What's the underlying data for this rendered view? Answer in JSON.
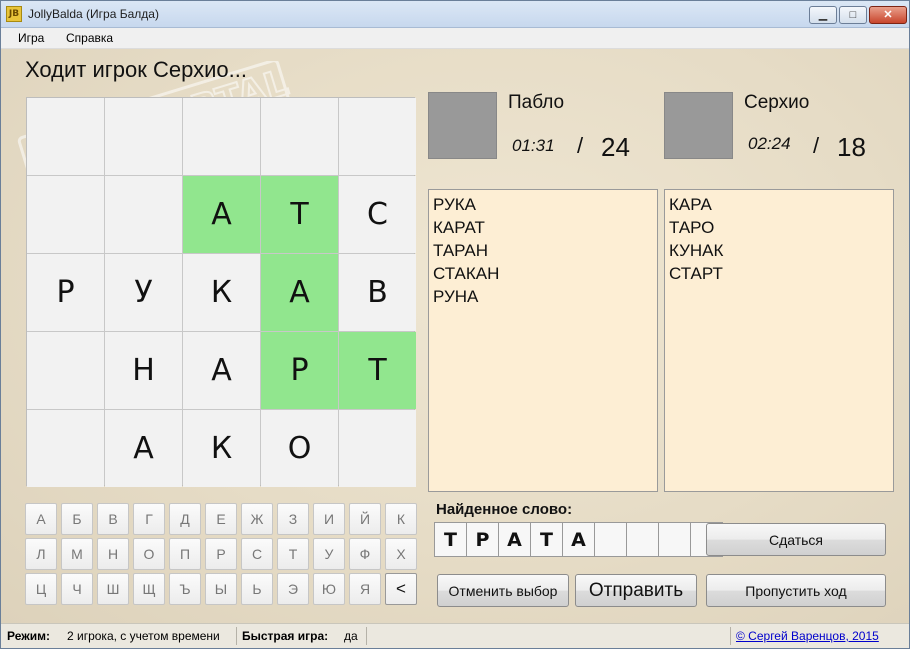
{
  "window": {
    "title": "JollyBalda (Игра Балда)",
    "icon_text": "JB"
  },
  "menu": {
    "items": [
      "Игра",
      "Справка"
    ]
  },
  "status_line": "Ходит игрок Серхио...",
  "board": [
    [
      "",
      "",
      "",
      "",
      ""
    ],
    [
      "",
      "",
      "А",
      "Т",
      "С"
    ],
    [
      "Р",
      "У",
      "К",
      "А",
      "В"
    ],
    [
      "",
      "Н",
      "А",
      "Р",
      "Т"
    ],
    [
      "",
      "А",
      "К",
      "О",
      ""
    ]
  ],
  "board_highlight": [
    [
      1,
      2
    ],
    [
      1,
      3
    ],
    [
      2,
      3
    ],
    [
      3,
      3
    ],
    [
      3,
      4
    ]
  ],
  "players": [
    {
      "name": "Пабло",
      "time": "01:31",
      "slash": "/",
      "score": "24",
      "words": [
        "РУКА",
        "КАРАТ",
        "ТАРАН",
        "СТАКАН",
        "РУНА"
      ]
    },
    {
      "name": "Серхио",
      "time": "02:24",
      "slash": "/",
      "score": "18",
      "words": [
        "КАРА",
        "ТАРО",
        "КУНАК",
        "СТАРТ"
      ]
    }
  ],
  "keyboard": {
    "rows": [
      [
        "А",
        "Б",
        "В",
        "Г",
        "Д",
        "Е",
        "Ж",
        "З",
        "И",
        "Й",
        "К"
      ],
      [
        "Л",
        "М",
        "Н",
        "О",
        "П",
        "Р",
        "С",
        "Т",
        "У",
        "Ф",
        "Х"
      ],
      [
        "Ц",
        "Ч",
        "Ш",
        "Щ",
        "Ъ",
        "Ы",
        "Ь",
        "Э",
        "Ю",
        "Я",
        "<"
      ]
    ]
  },
  "found_word": {
    "label": "Найденное слово:",
    "letters": [
      "Т",
      "Р",
      "А",
      "Т",
      "А",
      "",
      "",
      "",
      ""
    ]
  },
  "buttons": {
    "surrender": "Сдаться",
    "cancel_selection": "Отменить выбор",
    "submit": "Отправить",
    "skip_turn": "Пропустить ход"
  },
  "status_bar": {
    "mode_label": "Режим:",
    "mode_value": "2 игрока, с учетом времени",
    "quick_label": "Быстрая игра:",
    "quick_value": "да",
    "copyright": "© Сергей Варенцов, 2015"
  },
  "watermark": {
    "text": "SOFTPORTAL",
    "url": "www.softportal.com"
  },
  "colors": {
    "highlight": "#91e68e",
    "wordlist_bg": "#fdeed4",
    "avatar": "#999999"
  }
}
